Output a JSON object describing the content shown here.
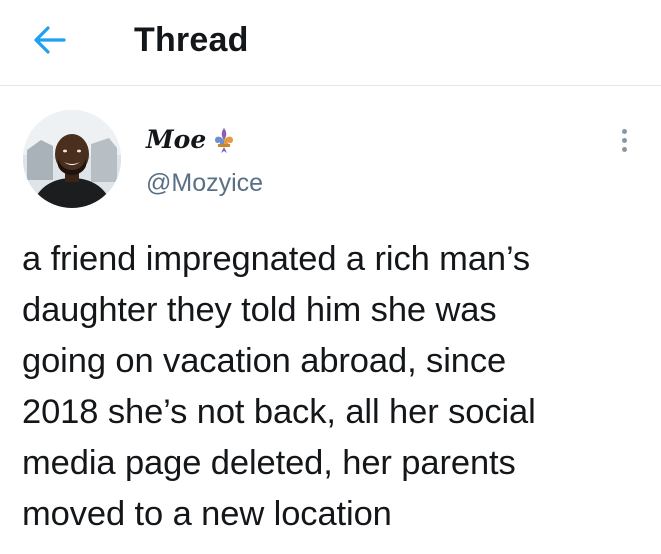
{
  "header": {
    "title": "Thread",
    "back_icon": "arrow-left-icon"
  },
  "tweet": {
    "author": {
      "display_name": "Moe",
      "badge_icon": "fleur-de-lis-icon",
      "handle": "@Mozyice"
    },
    "text": "a friend impregnated a rich man’s\ndaughter they told him she was\ngoing on vacation abroad, since\n2018 she’s not back, all her social\nmedia page deleted, her parents\nmoved to a new location",
    "more_icon": "more-vertical-icon"
  },
  "colors": {
    "accent": "#1da1f2",
    "text": "#14171a",
    "secondary_text": "#5b7083",
    "divider": "#e1e6ea"
  }
}
